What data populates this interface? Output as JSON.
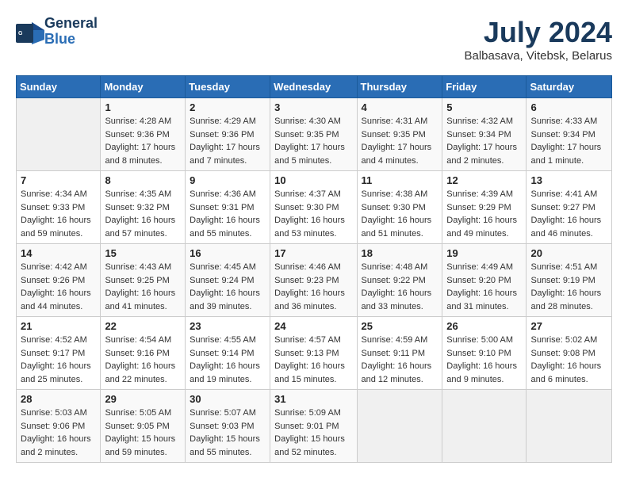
{
  "header": {
    "logo_line1": "General",
    "logo_line2": "Blue",
    "title": "July 2024",
    "subtitle": "Balbasava, Vitebsk, Belarus"
  },
  "calendar": {
    "days_of_week": [
      "Sunday",
      "Monday",
      "Tuesday",
      "Wednesday",
      "Thursday",
      "Friday",
      "Saturday"
    ],
    "weeks": [
      [
        {
          "num": "",
          "info": ""
        },
        {
          "num": "1",
          "info": "Sunrise: 4:28 AM\nSunset: 9:36 PM\nDaylight: 17 hours\nand 8 minutes."
        },
        {
          "num": "2",
          "info": "Sunrise: 4:29 AM\nSunset: 9:36 PM\nDaylight: 17 hours\nand 7 minutes."
        },
        {
          "num": "3",
          "info": "Sunrise: 4:30 AM\nSunset: 9:35 PM\nDaylight: 17 hours\nand 5 minutes."
        },
        {
          "num": "4",
          "info": "Sunrise: 4:31 AM\nSunset: 9:35 PM\nDaylight: 17 hours\nand 4 minutes."
        },
        {
          "num": "5",
          "info": "Sunrise: 4:32 AM\nSunset: 9:34 PM\nDaylight: 17 hours\nand 2 minutes."
        },
        {
          "num": "6",
          "info": "Sunrise: 4:33 AM\nSunset: 9:34 PM\nDaylight: 17 hours\nand 1 minute."
        }
      ],
      [
        {
          "num": "7",
          "info": "Sunrise: 4:34 AM\nSunset: 9:33 PM\nDaylight: 16 hours\nand 59 minutes."
        },
        {
          "num": "8",
          "info": "Sunrise: 4:35 AM\nSunset: 9:32 PM\nDaylight: 16 hours\nand 57 minutes."
        },
        {
          "num": "9",
          "info": "Sunrise: 4:36 AM\nSunset: 9:31 PM\nDaylight: 16 hours\nand 55 minutes."
        },
        {
          "num": "10",
          "info": "Sunrise: 4:37 AM\nSunset: 9:30 PM\nDaylight: 16 hours\nand 53 minutes."
        },
        {
          "num": "11",
          "info": "Sunrise: 4:38 AM\nSunset: 9:30 PM\nDaylight: 16 hours\nand 51 minutes."
        },
        {
          "num": "12",
          "info": "Sunrise: 4:39 AM\nSunset: 9:29 PM\nDaylight: 16 hours\nand 49 minutes."
        },
        {
          "num": "13",
          "info": "Sunrise: 4:41 AM\nSunset: 9:27 PM\nDaylight: 16 hours\nand 46 minutes."
        }
      ],
      [
        {
          "num": "14",
          "info": "Sunrise: 4:42 AM\nSunset: 9:26 PM\nDaylight: 16 hours\nand 44 minutes."
        },
        {
          "num": "15",
          "info": "Sunrise: 4:43 AM\nSunset: 9:25 PM\nDaylight: 16 hours\nand 41 minutes."
        },
        {
          "num": "16",
          "info": "Sunrise: 4:45 AM\nSunset: 9:24 PM\nDaylight: 16 hours\nand 39 minutes."
        },
        {
          "num": "17",
          "info": "Sunrise: 4:46 AM\nSunset: 9:23 PM\nDaylight: 16 hours\nand 36 minutes."
        },
        {
          "num": "18",
          "info": "Sunrise: 4:48 AM\nSunset: 9:22 PM\nDaylight: 16 hours\nand 33 minutes."
        },
        {
          "num": "19",
          "info": "Sunrise: 4:49 AM\nSunset: 9:20 PM\nDaylight: 16 hours\nand 31 minutes."
        },
        {
          "num": "20",
          "info": "Sunrise: 4:51 AM\nSunset: 9:19 PM\nDaylight: 16 hours\nand 28 minutes."
        }
      ],
      [
        {
          "num": "21",
          "info": "Sunrise: 4:52 AM\nSunset: 9:17 PM\nDaylight: 16 hours\nand 25 minutes."
        },
        {
          "num": "22",
          "info": "Sunrise: 4:54 AM\nSunset: 9:16 PM\nDaylight: 16 hours\nand 22 minutes."
        },
        {
          "num": "23",
          "info": "Sunrise: 4:55 AM\nSunset: 9:14 PM\nDaylight: 16 hours\nand 19 minutes."
        },
        {
          "num": "24",
          "info": "Sunrise: 4:57 AM\nSunset: 9:13 PM\nDaylight: 16 hours\nand 15 minutes."
        },
        {
          "num": "25",
          "info": "Sunrise: 4:59 AM\nSunset: 9:11 PM\nDaylight: 16 hours\nand 12 minutes."
        },
        {
          "num": "26",
          "info": "Sunrise: 5:00 AM\nSunset: 9:10 PM\nDaylight: 16 hours\nand 9 minutes."
        },
        {
          "num": "27",
          "info": "Sunrise: 5:02 AM\nSunset: 9:08 PM\nDaylight: 16 hours\nand 6 minutes."
        }
      ],
      [
        {
          "num": "28",
          "info": "Sunrise: 5:03 AM\nSunset: 9:06 PM\nDaylight: 16 hours\nand 2 minutes."
        },
        {
          "num": "29",
          "info": "Sunrise: 5:05 AM\nSunset: 9:05 PM\nDaylight: 15 hours\nand 59 minutes."
        },
        {
          "num": "30",
          "info": "Sunrise: 5:07 AM\nSunset: 9:03 PM\nDaylight: 15 hours\nand 55 minutes."
        },
        {
          "num": "31",
          "info": "Sunrise: 5:09 AM\nSunset: 9:01 PM\nDaylight: 15 hours\nand 52 minutes."
        },
        {
          "num": "",
          "info": ""
        },
        {
          "num": "",
          "info": ""
        },
        {
          "num": "",
          "info": ""
        }
      ]
    ]
  }
}
